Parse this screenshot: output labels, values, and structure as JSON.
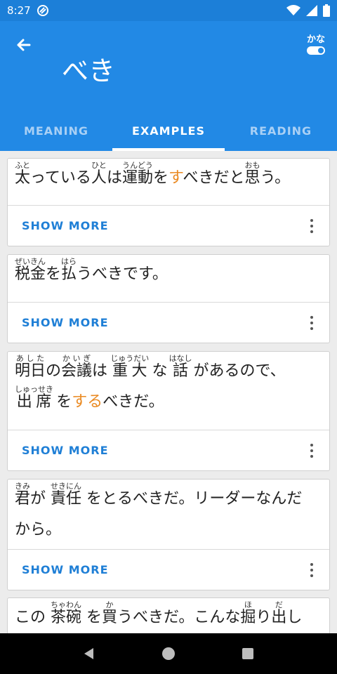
{
  "status": {
    "time": "8:27"
  },
  "header": {
    "title": "べき",
    "kana_toggle_label": "かな"
  },
  "tabs": [
    "MEANING",
    "EXAMPLES",
    "READING"
  ],
  "show_more_label": "SHOW MORE",
  "colors": {
    "app_bar": "#2289e5",
    "status_bar": "#1c7fd8",
    "highlight": "#ea8a22",
    "link": "#1f7fd6"
  },
  "examples": [
    {
      "lines": [
        [
          {
            "t": "太",
            "r": "ふと"
          },
          {
            "t": "っている"
          },
          {
            "t": "人",
            "r": "ひと"
          },
          {
            "t": "は"
          },
          {
            "t": "運動",
            "r": "うんどう"
          },
          {
            "t": "を"
          },
          {
            "t": "す",
            "h": true
          },
          {
            "t": "べきだと"
          },
          {
            "t": "思",
            "r": "おも"
          },
          {
            "t": "う。"
          }
        ]
      ]
    },
    {
      "lines": [
        [
          {
            "t": "税金",
            "r": "ぜいきん"
          },
          {
            "t": "を"
          },
          {
            "t": "払",
            "r": "はら"
          },
          {
            "t": "うべきです。"
          }
        ]
      ]
    },
    {
      "lines": [
        [
          {
            "t": "明日",
            "r": "あした"
          },
          {
            "t": "の"
          },
          {
            "t": "会議",
            "r": "かいぎ"
          },
          {
            "t": "は "
          },
          {
            "t": "重大",
            "r": "じゅうだい"
          },
          {
            "t": " な "
          },
          {
            "t": "話",
            "r": "はなし"
          },
          {
            "t": " があるので、"
          }
        ],
        [
          {
            "t": " 出席",
            "r": "しゅっせき"
          },
          {
            "t": " を"
          },
          {
            "t": "する",
            "h": true
          },
          {
            "t": "べきだ。"
          }
        ]
      ]
    },
    {
      "lines": [
        [
          {
            "t": "君",
            "r": "きみ"
          },
          {
            "t": "が "
          },
          {
            "t": "責任",
            "r": "せきにん"
          },
          {
            "t": " をとるべきだ。リーダーなんだ"
          }
        ],
        [
          {
            "t": "から。"
          }
        ]
      ]
    },
    {
      "lines": [
        [
          {
            "t": "この "
          },
          {
            "t": "茶碗",
            "r": "ちゃわん"
          },
          {
            "t": " を"
          },
          {
            "t": "買",
            "r": "か"
          },
          {
            "t": "うべきだ。こんな"
          },
          {
            "t": "掘",
            "r": "ほ"
          },
          {
            "t": "り"
          },
          {
            "t": "出",
            "r": "だ"
          },
          {
            "t": "し"
          }
        ]
      ]
    }
  ]
}
